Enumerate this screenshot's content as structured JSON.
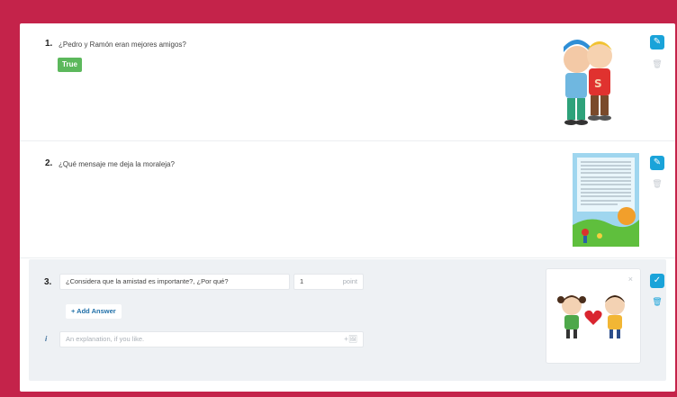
{
  "questions": [
    {
      "number": "1.",
      "text": "¿Pedro y Ramón eran mejores amigos?",
      "answer": "True"
    },
    {
      "number": "2.",
      "text": "¿Qué mensaje me deja la moraleja?"
    },
    {
      "number": "3.",
      "text": "¿Considera que la amistad es importante?, ¿Por qué?",
      "points_value": "1",
      "points_label": "point",
      "add_answer_label": "+ Add Answer",
      "info_icon": "i",
      "explanation_placeholder": "An explanation, if you like.",
      "image_remove": "×"
    }
  ],
  "icons": {
    "edit": "pencil-icon",
    "delete": "trash-icon",
    "confirm": "check-icon",
    "add_image": "add-image-icon"
  },
  "colors": {
    "frame": "#c4234a",
    "accent": "#1aa3d9",
    "true_badge": "#5cb85c"
  }
}
